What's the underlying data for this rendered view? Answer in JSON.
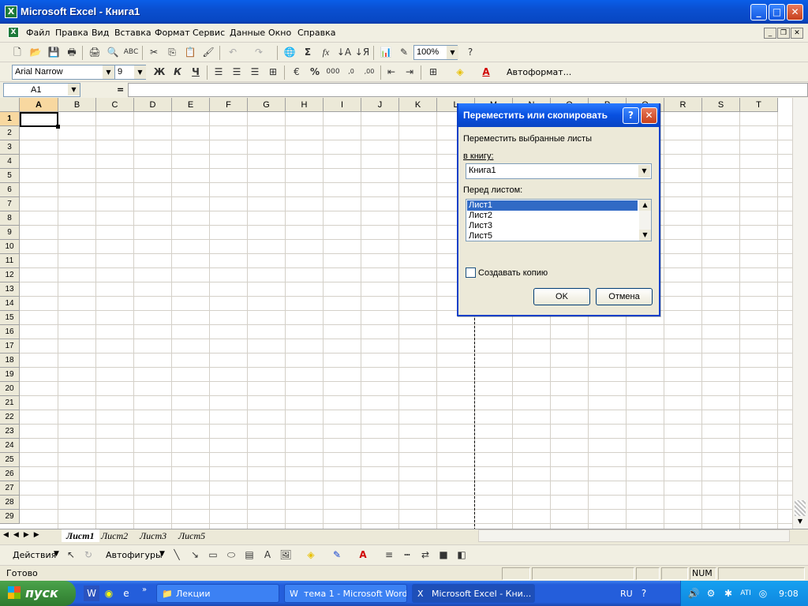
{
  "window": {
    "title": "Microsoft Excel - Книга1"
  },
  "menu": [
    "Файл",
    "Правка",
    "Вид",
    "Вставка",
    "Формат",
    "Сервис",
    "Данные",
    "Окно",
    "Справка"
  ],
  "toolbar": {
    "zoom": "100%",
    "font": "Arial Narrow",
    "font_size": "9",
    "bold": "Ж",
    "italic": "К",
    "underline": "Ч",
    "autoformat": "Автоформат...",
    "percent": "%",
    "thousands": "000",
    "sigma": "Σ",
    "fx": "fx"
  },
  "formula_bar": {
    "name_box": "A1",
    "equals": "="
  },
  "grid": {
    "columns": [
      "A",
      "B",
      "C",
      "D",
      "E",
      "F",
      "G",
      "H",
      "I",
      "J",
      "K",
      "L",
      "M",
      "N",
      "O",
      "P",
      "Q",
      "R",
      "S",
      "T"
    ],
    "rows": [
      "1",
      "2",
      "3",
      "4",
      "5",
      "6",
      "7",
      "8",
      "9",
      "10",
      "11",
      "12",
      "13",
      "14",
      "15",
      "16",
      "17",
      "18",
      "19",
      "20",
      "21",
      "22",
      "23",
      "24",
      "25",
      "26",
      "27",
      "28",
      "29"
    ]
  },
  "dialog": {
    "title": "Переместить или скопировать",
    "help": "?",
    "close": "✕",
    "label_move": "Переместить выбранные листы",
    "label_book": "в книгу:",
    "book_value": "Книга1",
    "label_before": "Перед листом:",
    "sheets": [
      "Лист1",
      "Лист2",
      "Лист3",
      "Лист5"
    ],
    "copy_label": "Создавать копию",
    "ok": "OK",
    "cancel": "Отмена"
  },
  "sheet_tabs": [
    "Лист1",
    "Лист2",
    "Лист3",
    "Лист5"
  ],
  "drawing": {
    "actions": "Действия",
    "autoshapes": "Автофигуры"
  },
  "status": {
    "ready": "Готово",
    "num": "NUM"
  },
  "taskbar": {
    "start": "пуск",
    "lang": "RU",
    "clock": "9:08",
    "buttons": [
      "Лекции",
      "тема 1 - Microsoft Word",
      "Microsoft Excel - Кни..."
    ]
  }
}
